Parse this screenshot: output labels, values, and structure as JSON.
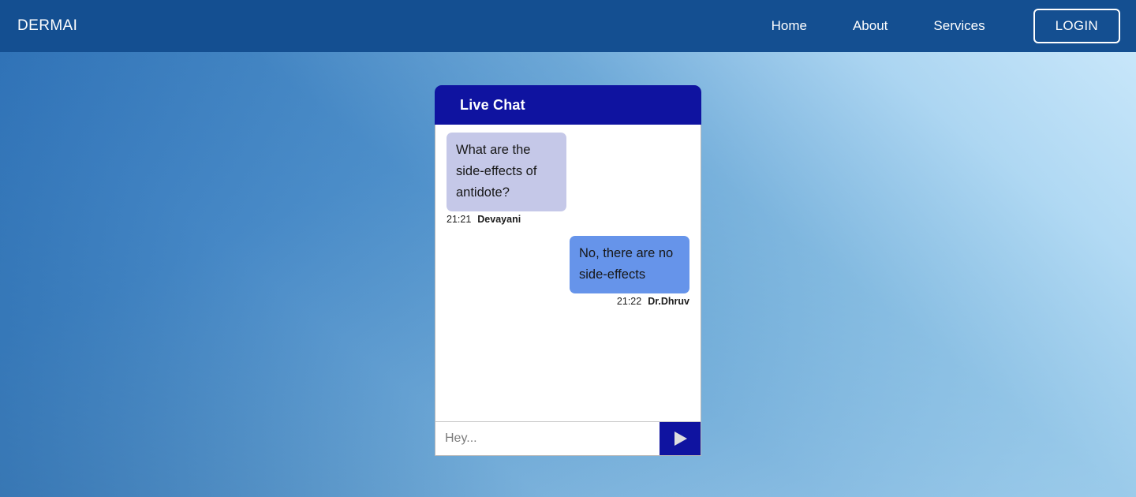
{
  "navbar": {
    "brand": "DERMAI",
    "links": [
      {
        "label": "Home"
      },
      {
        "label": "About"
      },
      {
        "label": "Services"
      }
    ],
    "login_label": "LOGIN",
    "bg_color": "#144f91"
  },
  "chat": {
    "title": "Live Chat",
    "header_color": "#0f13a0",
    "messages": [
      {
        "text": "What are the side-effects of antidote?",
        "time": "21:21",
        "author": "Devayani",
        "side": "left",
        "bubble_color": "#c5c8e8"
      },
      {
        "text": "No, there are no side-effects",
        "time": "21:22",
        "author": "Dr.Dhruv",
        "side": "right",
        "bubble_color": "#6694ea"
      }
    ],
    "input": {
      "value": "",
      "placeholder": "Hey...",
      "send_icon": "send-triangle-icon"
    }
  },
  "background": {
    "from_color": "#1a5a9e",
    "to_color": "#cdeafc"
  }
}
